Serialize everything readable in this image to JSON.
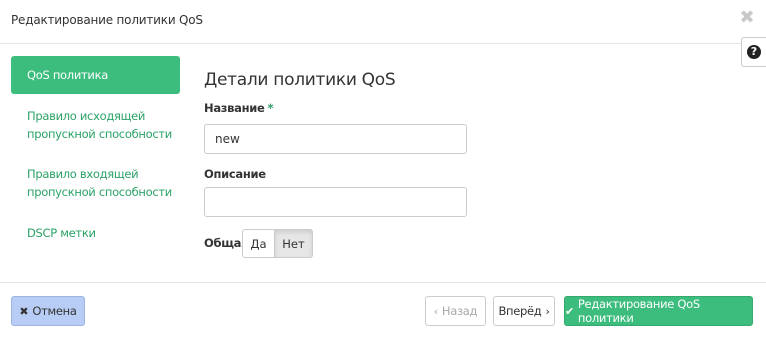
{
  "modal": {
    "title": "Редактирование политики QoS",
    "close_icon": "close-icon",
    "help_icon": "question-circle-icon",
    "help_glyph": "?"
  },
  "sidebar": {
    "items": [
      {
        "label": "QoS политика",
        "active": true
      },
      {
        "label_line1": "Правило исходящей",
        "label_line2": "пропускной способности",
        "active": false
      },
      {
        "label_line1": "Правило входящей",
        "label_line2": "пропускной способности",
        "active": false
      },
      {
        "label": "DSCP метки",
        "active": false
      }
    ]
  },
  "form": {
    "section_title": "Детали политики QoS",
    "name_label": "Название",
    "name_required_mark": "*",
    "name_value": "new",
    "description_label": "Описание",
    "description_value": "",
    "shared_label": "Общая",
    "shared_options": {
      "yes": "Да",
      "no": "Нет"
    },
    "shared_selected": "Нет"
  },
  "footer": {
    "cancel_label": "Отмена",
    "cancel_icon": "times-icon",
    "back_label": "Назад",
    "back_icon": "chevron-left-icon",
    "next_label": "Вперёд",
    "next_icon": "chevron-right-icon",
    "submit_label": "Редактирование QoS политики",
    "submit_icon": "check-icon"
  },
  "colors": {
    "accent_green": "#3dbd7d",
    "link_green": "#2aa266",
    "cancel_blue": "#b8cdf5"
  }
}
